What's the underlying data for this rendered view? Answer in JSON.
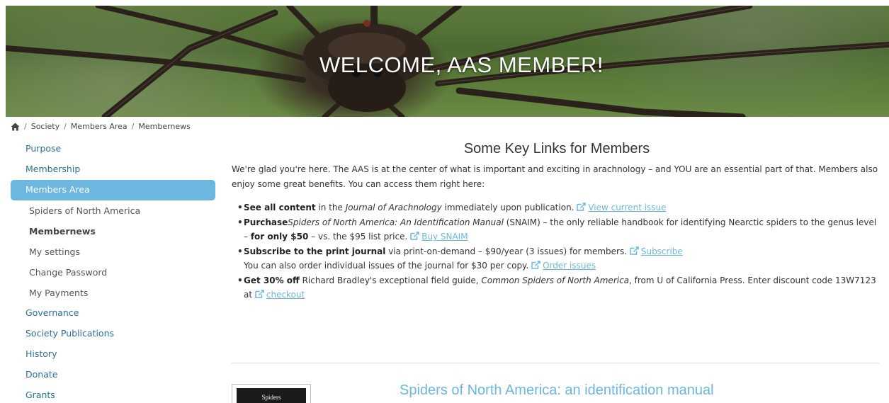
{
  "hero": {
    "title": "WELCOME, AAS MEMBER!"
  },
  "breadcrumb": {
    "home_icon": "home-icon",
    "separator": "/",
    "items": [
      "Society",
      "Members Area",
      "Membernews"
    ]
  },
  "sidebar": {
    "items": [
      {
        "label": "Purpose"
      },
      {
        "label": "Membership"
      },
      {
        "label": "Members Area"
      },
      {
        "label": "Spiders of North America"
      },
      {
        "label": "Membernews"
      },
      {
        "label": "My settings"
      },
      {
        "label": "Change Password"
      },
      {
        "label": "My Payments"
      },
      {
        "label": "Governance"
      },
      {
        "label": "Society Publications"
      },
      {
        "label": "History"
      },
      {
        "label": "Donate"
      },
      {
        "label": "Grants"
      }
    ]
  },
  "main": {
    "title": "Some Key Links for Members",
    "intro": "We're glad you're here. The AAS is at the center of what is important and exciting in arachnology – and YOU are an essential part of that. Members also enjoy some great benefits. You can access them right here:",
    "links": [
      {
        "bold": "See all content",
        "text1": " in the ",
        "italic": "Journal of Arachnology",
        "text2": " immediately upon publication. ",
        "link": "View current issue"
      },
      {
        "bold": "Purchase",
        "italic": "Spiders of North America: An Identification Manual",
        "text1": " (SNAIM) – the only reliable handbook for identifying Nearctic spiders to the genus level – ",
        "bold2": "for only $50",
        "text2": " – vs. the $95 list price. ",
        "link": "Buy SNAIM"
      },
      {
        "bold": "Subscribe to the print journal",
        "text1": " via print-on-demand – $90/year (3 issues) for members. ",
        "link": "Subscribe",
        "line2": "You can also order individual issues of the journal for $30 per copy. ",
        "link2": "Order issues"
      },
      {
        "bold": "Get 30% off",
        "text1": " Richard Bradley's exceptional field guide, ",
        "italic": "Common Spiders of North America",
        "text2": ", from U of California Press. Enter discount code 13W7123 at ",
        "link": "checkout"
      }
    ],
    "icon": "external-link-icon",
    "accent_color": "#6bb7df"
  },
  "book": {
    "thumb_text": "Spiders",
    "title": "Spiders of North America: an identification manual"
  }
}
